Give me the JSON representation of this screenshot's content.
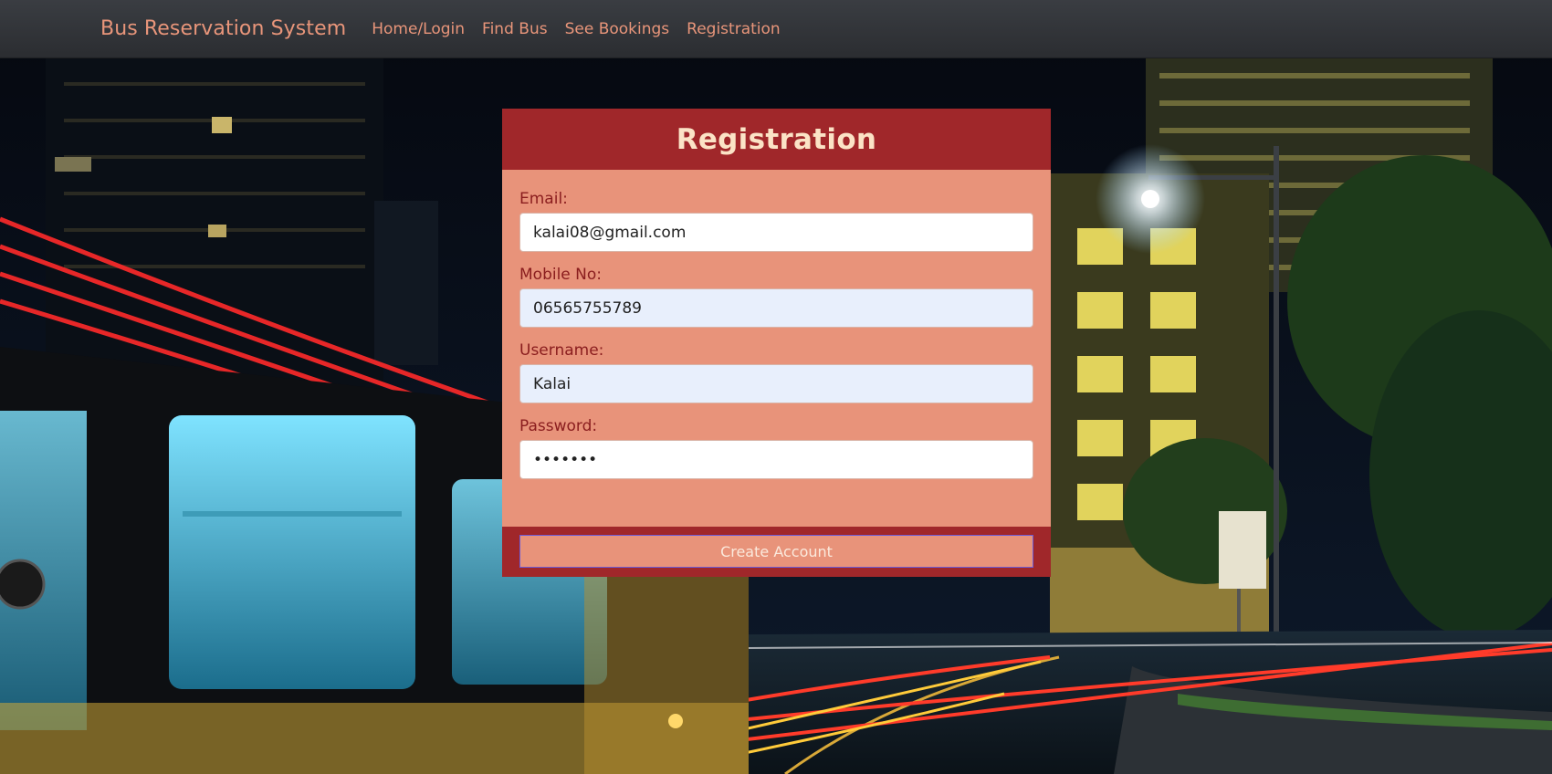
{
  "navbar": {
    "brand": "Bus Reservation System",
    "links": [
      {
        "label": "Home/Login"
      },
      {
        "label": "Find Bus"
      },
      {
        "label": "See Bookings"
      },
      {
        "label": "Registration"
      }
    ]
  },
  "form": {
    "title": "Registration",
    "fields": [
      {
        "label": "Email:",
        "value": "kalai08@gmail.com",
        "type": "email"
      },
      {
        "label": "Mobile No:",
        "value": "06565755789",
        "type": "tel"
      },
      {
        "label": "Username:",
        "value": "Kalai",
        "type": "text"
      },
      {
        "label": "Password:",
        "value": "1234567",
        "type": "password"
      }
    ],
    "submit_label": "Create Account"
  },
  "colors": {
    "navbar_bg": "#2f3135",
    "nav_text": "#e8957a",
    "card_bg": "#e8937a",
    "card_header_bg": "#a0272a",
    "title_text": "#fbe3c6",
    "label_text": "#8a1d1e"
  },
  "icons": {
    "background": "night-city-street-bus-image"
  }
}
